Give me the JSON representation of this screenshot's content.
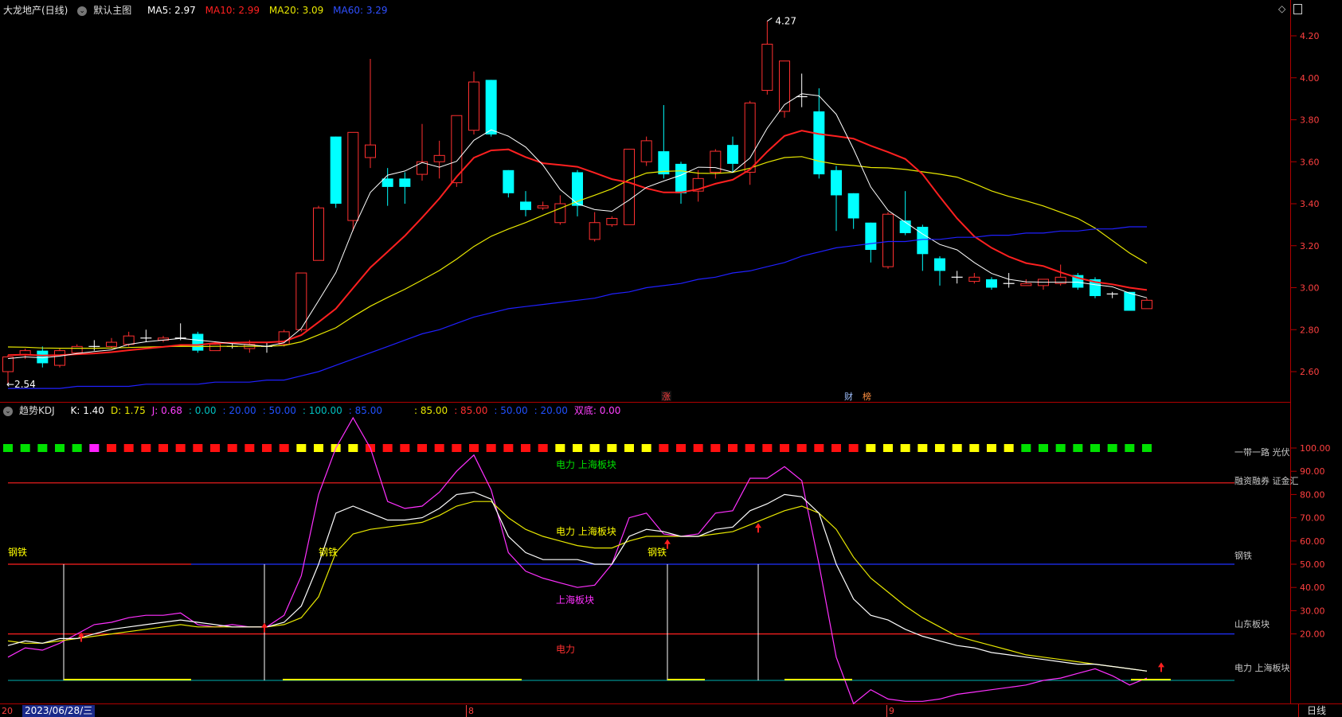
{
  "top_pane": {
    "title": "大龙地产(日线)",
    "indicator_name": "默认主图",
    "ma5": "MA5: 2.97",
    "ma10": "MA10: 2.99",
    "ma20": "MA20: 3.09",
    "ma60": "MA60: 3.29",
    "high_label": "4.27",
    "low_label": "2.54",
    "event_markers": [
      "涨",
      "财",
      "榜"
    ],
    "price_ticks": [
      "4.20",
      "4.00",
      "3.80",
      "3.60",
      "3.40",
      "3.20",
      "3.00",
      "2.80",
      "2.60"
    ],
    "colors": {
      "up": "#ff3030",
      "down": "#00ffff",
      "ma5": "#ffffff",
      "ma10": "#ff2020",
      "ma20": "#e8e800",
      "ma60": "#2020ff"
    }
  },
  "bottom_pane": {
    "indicator_name": "趋势KDJ",
    "legend": [
      {
        "text": "K: 1.40",
        "color": "#ffffff"
      },
      {
        "text": "D: 1.75",
        "color": "#e8e800"
      },
      {
        "text": "J: 0.68",
        "color": "#ff40ff"
      },
      {
        "text": ": 0.00",
        "color": "#00c0c0"
      },
      {
        "text": ": 20.00",
        "color": "#2050ff"
      },
      {
        "text": ": 50.00",
        "color": "#2050ff"
      },
      {
        "text": ": 100.00",
        "color": "#00c0c0"
      },
      {
        "text": ": 85.00",
        "color": "#2050ff"
      },
      {
        "text": ": 85.00",
        "color": "#e8e800"
      },
      {
        "text": ": 85.00",
        "color": "#ff3030"
      },
      {
        "text": ": 50.00",
        "color": "#2050ff"
      },
      {
        "text": ": 20.00",
        "color": "#2050ff"
      },
      {
        "text": "双底: 0.00",
        "color": "#ff40ff"
      }
    ],
    "kdj_ticks": [
      "100.00",
      "90.00",
      "80.00",
      "70.00",
      "60.00",
      "50.00",
      "40.00",
      "30.00",
      "20.00"
    ],
    "right_labels": [
      "一带一路 光伏 ",
      "融资融券 证金汇",
      "钢铁",
      "山东板块",
      "电力 上海板块"
    ],
    "chart_labels": {
      "dianli_shanghai_top": "电力 上海板块",
      "dianli_shanghai_mid": "电力 上海板块",
      "shanghai": "上海板块",
      "dianli": "电力",
      "gangtie": "钢铁"
    }
  },
  "footer": {
    "left_text": "20",
    "date": "2023/06/28/三",
    "month_8": "8",
    "month_9": "9",
    "period_button": "日线"
  }
}
